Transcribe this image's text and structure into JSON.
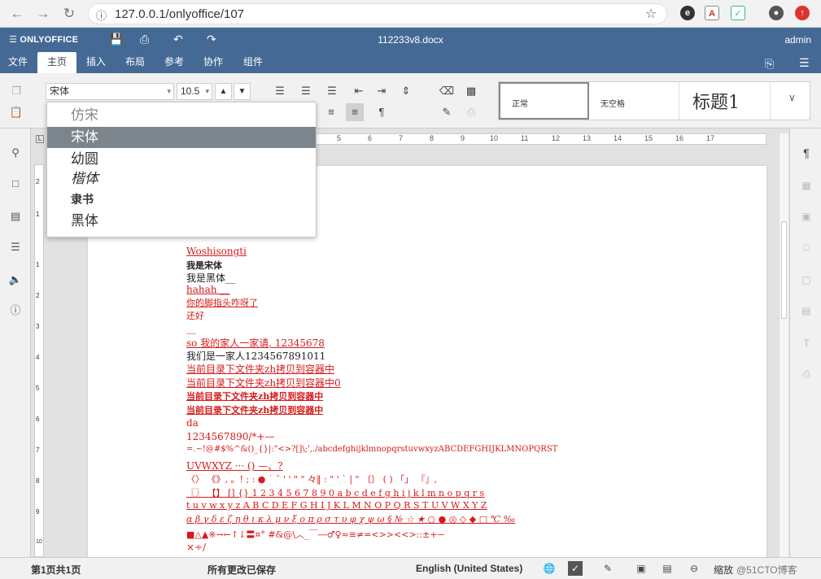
{
  "browser": {
    "url": "127.0.0.1/onlyoffice/107",
    "back_icon": "arrow-left-icon",
    "forward_icon": "arrow-right-icon",
    "reload_icon": "reload-icon"
  },
  "app": {
    "logo_text": "ONLYOFFICE",
    "doc_title": "112233v8.docx",
    "user": "admin"
  },
  "menu_tabs": [
    "文件",
    "主页",
    "插入",
    "布局",
    "参考",
    "协作",
    "组件"
  ],
  "active_tab": "主页",
  "toolbar": {
    "font_name": "宋体",
    "font_size": "10.5"
  },
  "styles": {
    "normal": "正常",
    "no_spacing": "无空格",
    "heading1": "标题1"
  },
  "font_dropdown": {
    "options": [
      "仿宋",
      "宋体",
      "幼圆",
      "楷体",
      "隶书",
      "黑体"
    ],
    "selected": "宋体"
  },
  "ruler": {
    "marks": [
      "5",
      "6",
      "7",
      "8",
      "9",
      "10",
      "11",
      "12",
      "13",
      "14",
      "15",
      "16",
      "17"
    ],
    "vmarks": [
      "2",
      "1",
      "1",
      "2",
      "3",
      "4",
      "5",
      "6",
      "7",
      "8",
      "9",
      "10"
    ]
  },
  "document_lines": [
    "Woshisongti",
    "我是宋体",
    "我是黑体__",
    "hahah  __",
    "你的脚指头咋呀了  ",
    "还好",
    "__",
    "so  我的家人一家请, 12345678",
    "我们是一家人1234567891011",
    "当前目录下文件夹zh拷贝到容器中",
    "当前目录下文件夹zh拷贝到容器中0",
    "当前目录下文件夹zh拷贝到容器中",
    "当前目录下文件夹zh拷贝到容器中",
    "da",
    "1234567890/*+—",
    "=.~!@#$%^&()_{}|:\"<>?[]\\;',./abcdefghijklmnopqrstuvwxyzABCDEFGHIJKLMNOPQRST",
    "UVWXYZ ··· () —、?",
    " 〈〉 《》, 。! ; : ● ˙ ˉ ' ' \" \" 々‖ : \" ' ` | \" 〔〕 ( ) 「」 『』,",
    "〖〗 【】 [] {} 1 2 3 4 5 6 7 8 9 0 a b c d e f g h i j k l m n o p q r s",
    " t u v w x y z A B C D E F G H I J K L M N O P Q R S T U V W X Y Z",
    " α β γ δ ε ζ η θ ι κ λ μ ν ξ ο π ρ σ τ υ φ χ ψ ω § № ☆ ★ ○ ● ◎ ◇ ◆ □ ℃ ‰",
    "■△▲※→←↑↓〓¤° #&@\\︿_￣―♂♀≈≡≠=<>><<>::±+−",
    "×÷/"
  ],
  "status": {
    "page_info": "第1页共1页",
    "save_status": "所有更改已保存",
    "language": "English (United States)",
    "zoom_label": "缩放",
    "watermark": "@51CTO博客"
  }
}
